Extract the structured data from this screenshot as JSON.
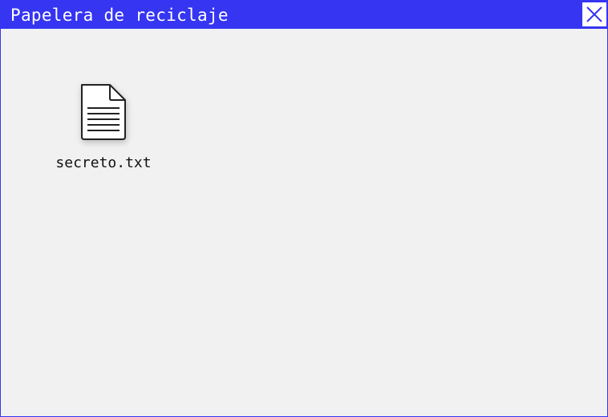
{
  "window": {
    "title": "Papelera de reciclaje",
    "accent_color": "#3535f2",
    "background_color": "#f1f1f1",
    "close_icon": "close-icon"
  },
  "files": [
    {
      "name": "secreto.txt",
      "icon": "text-file-icon"
    }
  ]
}
